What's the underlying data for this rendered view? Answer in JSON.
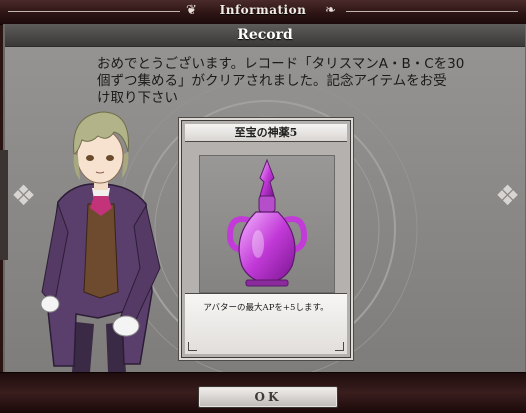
{
  "header": {
    "title": "Information"
  },
  "dialog": {
    "title": "Record",
    "message_lines": [
      "おめでとうございます。レコード「タリスマンA・B・Cを30",
      "個ずつ集める」がクリアされました。記念アイテムをお受",
      "け取り下さい"
    ]
  },
  "reward_card": {
    "name": "至宝の神薬5",
    "description": "アバターの最大APを+5します。",
    "icon": "potion-icon",
    "potion_color": "#c23ad8"
  },
  "footer": {
    "ok_label": "OK"
  },
  "colors": {
    "frame_dark": "#2b1313",
    "panel_gray": "#8c8a88",
    "header_text": "#f3ece6"
  }
}
